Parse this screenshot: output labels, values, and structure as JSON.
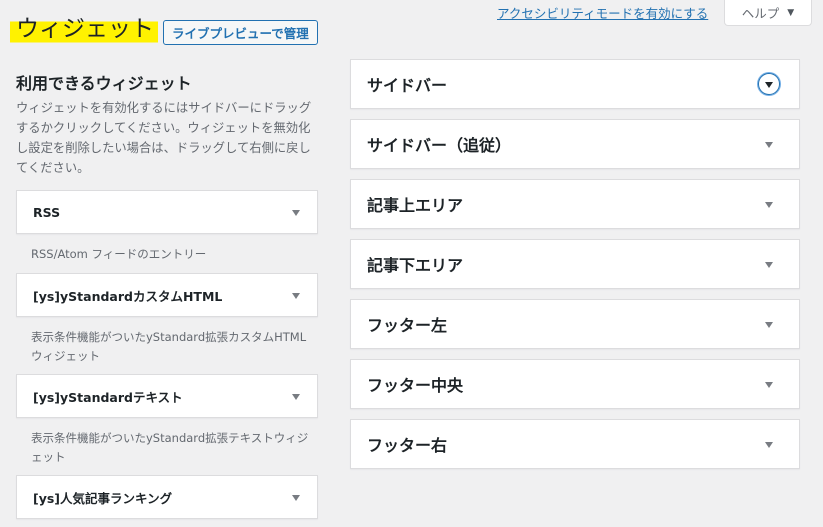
{
  "header": {
    "title": "ウィジェット",
    "live_preview_button": "ライブプレビューで管理",
    "accessibility_link": "アクセシビリティモードを有効にする",
    "help_tab": "ヘルプ"
  },
  "available": {
    "title": "利用できるウィジェット",
    "description": "ウィジェットを有効化するにはサイドバーにドラッグするかクリックしてください。ウィジェットを無効化し設定を削除したい場合は、ドラッグして右側に戻してください。",
    "widgets": [
      {
        "title": "RSS",
        "description": "RSS/Atom フィードのエントリー"
      },
      {
        "title": "[ys]yStandardカスタムHTML",
        "description": "表示条件機能がついたyStandard拡張カスタムHTMLウィジェット"
      },
      {
        "title": "[ys]yStandardテキスト",
        "description": "表示条件機能がついたyStandard拡張テキストウィジェット"
      },
      {
        "title": "[ys]人気記事ランキング",
        "description": ""
      }
    ]
  },
  "areas": [
    {
      "title": "サイドバー"
    },
    {
      "title": "サイドバー（追従）"
    },
    {
      "title": "記事上エリア"
    },
    {
      "title": "記事下エリア"
    },
    {
      "title": "フッター左"
    },
    {
      "title": "フッター中央"
    },
    {
      "title": "フッター右"
    }
  ],
  "colors": {
    "highlight": "#fff200",
    "link": "#2271b1",
    "background": "#f0f0f1"
  }
}
